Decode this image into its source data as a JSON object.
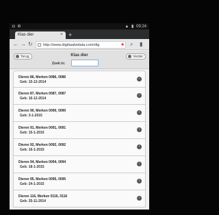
{
  "status_bar": {
    "left_icons": "◘ ⚙",
    "signal": "▲",
    "battery": "▮",
    "time": "09:24"
  },
  "browser": {
    "tab_title": "Klas dier",
    "tab_close": "×",
    "new_tab": "+",
    "url": "http://www.digitiaalwdata.com/dig"
  },
  "page": {
    "back_label": "Terug",
    "title": "Klas dier",
    "next_label": "Verder",
    "search_label": "Zoek in:",
    "search_value": ""
  },
  "items": [
    {
      "title": "Dieren 86, Merken 0086, 0086",
      "sub": "Geb: 15-12-2014"
    },
    {
      "title": "Dieren 87, Merken 0087, 0087",
      "sub": "Geb: 16-12-2014"
    },
    {
      "title": "Dieren 90, Merken 0090, 0090",
      "sub": "Geb: 3-1-2015"
    },
    {
      "title": "Dieren 91, Merken 0091, 0091",
      "sub": "Geb: 15-1-2015"
    },
    {
      "title": "Dieren 92, Merken 0092, 0092",
      "sub": "Geb: 16-1-2015"
    },
    {
      "title": "Dieren 94, Merken 0094, 0094",
      "sub": "Geb: 18-1-2015"
    },
    {
      "title": "Dieren 95, Merken 0095, 0095",
      "sub": "Geb: 24-1-2015"
    },
    {
      "title": "Dieren 116, Merken 0116, 0116",
      "sub": "Geb: 25-11-2014"
    }
  ]
}
